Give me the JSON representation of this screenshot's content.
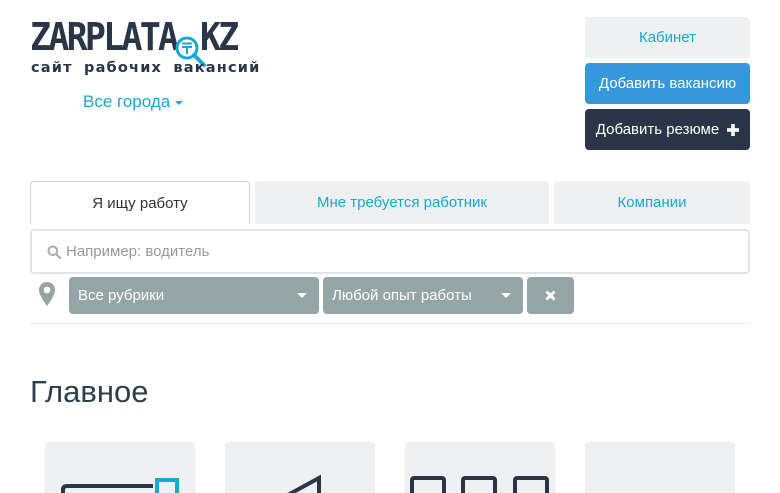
{
  "logo": {
    "brand_main": "ZARPLATA",
    "brand_tail": "KZ",
    "tagline": "сайт рабочих вакансий"
  },
  "city": {
    "label": "Все города"
  },
  "header_buttons": {
    "cabinet": "Кабинет",
    "add_vacancy": "Добавить вакансию",
    "add_resume": "Добавить резюме"
  },
  "tabs": [
    {
      "label": "Я ищу работу",
      "active": true
    },
    {
      "label": "Мне требуется работник",
      "active": false
    },
    {
      "label": "Компании",
      "active": false
    }
  ],
  "search": {
    "placeholder": "Например: водитель",
    "value": ""
  },
  "filters": {
    "category": "Все рубрики",
    "experience": "Любой опыт работы"
  },
  "main": {
    "title": "Главное"
  },
  "colors": {
    "accent": "#17a8d6",
    "primary_button": "#3498db",
    "dark_button": "#2a3647",
    "select_bg": "#95a5a6",
    "brand_dark": "#2a3647"
  },
  "icons": [
    "search-icon",
    "location-pin-icon",
    "close-icon",
    "plus-icon",
    "magnifier-tenge-icon"
  ]
}
